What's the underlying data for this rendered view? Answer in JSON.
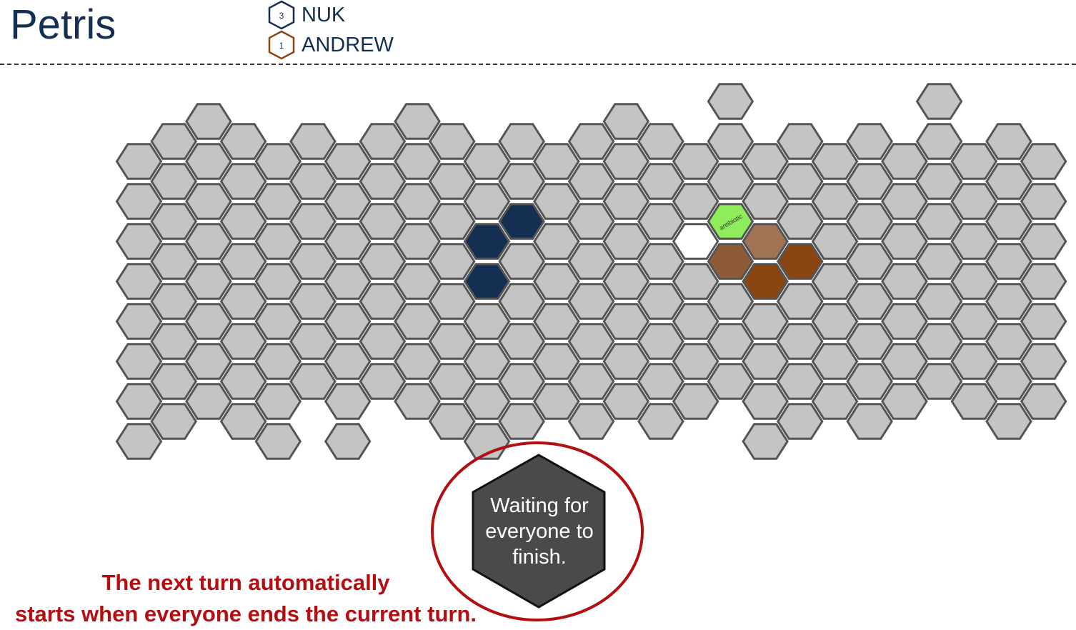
{
  "app": {
    "title": "Petris"
  },
  "players": [
    {
      "name": "NUK",
      "count": "3",
      "color": "#142f52"
    },
    {
      "name": "ANDREW",
      "count": "1",
      "color": "#8b4513"
    }
  ],
  "board": {
    "cell_color": "#c4c4c4",
    "stroke_color": "#555555",
    "cells": [
      {
        "col": 0,
        "row": 0,
        "color": "#c4c4c4"
      },
      {
        "col": 0,
        "row": 1,
        "color": "#c4c4c4"
      },
      {
        "col": 0,
        "row": 2,
        "color": "#c4c4c4"
      },
      {
        "col": 0,
        "row": 3,
        "color": "#c4c4c4"
      },
      {
        "col": 0,
        "row": 4,
        "color": "#c4c4c4"
      },
      {
        "col": 0,
        "row": 5,
        "color": "#c4c4c4"
      },
      {
        "col": 0,
        "row": 6,
        "color": "#c4c4c4"
      },
      {
        "col": 0,
        "row": 7,
        "color": "#c4c4c4"
      },
      {
        "col": 1,
        "row": 0,
        "color": "#c4c4c4"
      },
      {
        "col": 1,
        "row": 1,
        "color": "#c4c4c4"
      },
      {
        "col": 1,
        "row": 2,
        "color": "#c4c4c4"
      },
      {
        "col": 1,
        "row": 3,
        "color": "#c4c4c4"
      },
      {
        "col": 1,
        "row": 4,
        "color": "#c4c4c4"
      },
      {
        "col": 1,
        "row": 5,
        "color": "#c4c4c4"
      },
      {
        "col": 1,
        "row": 6,
        "color": "#c4c4c4"
      },
      {
        "col": 1,
        "row": 7,
        "color": "#c4c4c4"
      },
      {
        "col": 2,
        "row": -1,
        "color": "#c4c4c4"
      },
      {
        "col": 2,
        "row": 0,
        "color": "#c4c4c4"
      },
      {
        "col": 2,
        "row": 1,
        "color": "#c4c4c4"
      },
      {
        "col": 2,
        "row": 2,
        "color": "#c4c4c4"
      },
      {
        "col": 2,
        "row": 3,
        "color": "#c4c4c4"
      },
      {
        "col": 2,
        "row": 4,
        "color": "#c4c4c4"
      },
      {
        "col": 2,
        "row": 5,
        "color": "#c4c4c4"
      },
      {
        "col": 2,
        "row": 6,
        "color": "#c4c4c4"
      },
      {
        "col": 3,
        "row": 0,
        "color": "#c4c4c4"
      },
      {
        "col": 3,
        "row": 1,
        "color": "#c4c4c4"
      },
      {
        "col": 3,
        "row": 2,
        "color": "#c4c4c4"
      },
      {
        "col": 3,
        "row": 3,
        "color": "#c4c4c4"
      },
      {
        "col": 3,
        "row": 4,
        "color": "#c4c4c4"
      },
      {
        "col": 3,
        "row": 5,
        "color": "#c4c4c4"
      },
      {
        "col": 3,
        "row": 6,
        "color": "#c4c4c4"
      },
      {
        "col": 3,
        "row": 7,
        "color": "#c4c4c4"
      },
      {
        "col": 4,
        "row": 0,
        "color": "#c4c4c4"
      },
      {
        "col": 4,
        "row": 1,
        "color": "#c4c4c4"
      },
      {
        "col": 4,
        "row": 2,
        "color": "#c4c4c4"
      },
      {
        "col": 4,
        "row": 3,
        "color": "#c4c4c4"
      },
      {
        "col": 4,
        "row": 4,
        "color": "#c4c4c4"
      },
      {
        "col": 4,
        "row": 5,
        "color": "#c4c4c4"
      },
      {
        "col": 4,
        "row": 6,
        "color": "#c4c4c4"
      },
      {
        "col": 4,
        "row": 7,
        "color": "#c4c4c4"
      },
      {
        "col": 5,
        "row": 0,
        "color": "#c4c4c4"
      },
      {
        "col": 5,
        "row": 1,
        "color": "#c4c4c4"
      },
      {
        "col": 5,
        "row": 2,
        "color": "#c4c4c4"
      },
      {
        "col": 5,
        "row": 3,
        "color": "#c4c4c4"
      },
      {
        "col": 5,
        "row": 4,
        "color": "#c4c4c4"
      },
      {
        "col": 5,
        "row": 5,
        "color": "#c4c4c4"
      },
      {
        "col": 5,
        "row": 6,
        "color": "#c4c4c4"
      },
      {
        "col": 6,
        "row": 0,
        "color": "#c4c4c4"
      },
      {
        "col": 6,
        "row": 1,
        "color": "#c4c4c4"
      },
      {
        "col": 6,
        "row": 2,
        "color": "#c4c4c4"
      },
      {
        "col": 6,
        "row": 3,
        "color": "#c4c4c4"
      },
      {
        "col": 6,
        "row": 4,
        "color": "#c4c4c4"
      },
      {
        "col": 6,
        "row": 5,
        "color": "#c4c4c4"
      },
      {
        "col": 6,
        "row": 6,
        "color": "#c4c4c4"
      },
      {
        "col": 6,
        "row": 7,
        "color": "#c4c4c4"
      },
      {
        "col": 7,
        "row": 0,
        "color": "#c4c4c4"
      },
      {
        "col": 7,
        "row": 1,
        "color": "#c4c4c4"
      },
      {
        "col": 7,
        "row": 2,
        "color": "#c4c4c4"
      },
      {
        "col": 7,
        "row": 3,
        "color": "#c4c4c4"
      },
      {
        "col": 7,
        "row": 4,
        "color": "#c4c4c4"
      },
      {
        "col": 7,
        "row": 5,
        "color": "#c4c4c4"
      },
      {
        "col": 7,
        "row": 6,
        "color": "#c4c4c4"
      },
      {
        "col": 8,
        "row": -1,
        "color": "#c4c4c4"
      },
      {
        "col": 8,
        "row": 0,
        "color": "#c4c4c4"
      },
      {
        "col": 8,
        "row": 1,
        "color": "#c4c4c4"
      },
      {
        "col": 8,
        "row": 2,
        "color": "#c4c4c4"
      },
      {
        "col": 8,
        "row": 3,
        "color": "#c4c4c4"
      },
      {
        "col": 8,
        "row": 4,
        "color": "#c4c4c4"
      },
      {
        "col": 8,
        "row": 5,
        "color": "#c4c4c4"
      },
      {
        "col": 8,
        "row": 6,
        "color": "#c4c4c4"
      },
      {
        "col": 9,
        "row": 0,
        "color": "#c4c4c4"
      },
      {
        "col": 9,
        "row": 1,
        "color": "#c4c4c4"
      },
      {
        "col": 9,
        "row": 2,
        "color": "#c4c4c4"
      },
      {
        "col": 9,
        "row": 3,
        "color": "#c4c4c4"
      },
      {
        "col": 9,
        "row": 4,
        "color": "#c4c4c4"
      },
      {
        "col": 9,
        "row": 5,
        "color": "#c4c4c4"
      },
      {
        "col": 9,
        "row": 6,
        "color": "#c4c4c4"
      },
      {
        "col": 9,
        "row": 7,
        "color": "#c4c4c4"
      },
      {
        "col": 10,
        "row": 0,
        "color": "#c4c4c4"
      },
      {
        "col": 10,
        "row": 1,
        "color": "#c4c4c4"
      },
      {
        "col": 10,
        "row": 2,
        "color": "#142f52"
      },
      {
        "col": 10,
        "row": 3,
        "color": "#142f52"
      },
      {
        "col": 10,
        "row": 4,
        "color": "#c4c4c4"
      },
      {
        "col": 10,
        "row": 5,
        "color": "#c4c4c4"
      },
      {
        "col": 10,
        "row": 6,
        "color": "#c4c4c4"
      },
      {
        "col": 10,
        "row": 7,
        "color": "#c4c4c4"
      },
      {
        "col": 11,
        "row": 0,
        "color": "#c4c4c4"
      },
      {
        "col": 11,
        "row": 1,
        "color": "#c4c4c4"
      },
      {
        "col": 11,
        "row": 2,
        "color": "#142f52"
      },
      {
        "col": 11,
        "row": 3,
        "color": "#c4c4c4"
      },
      {
        "col": 11,
        "row": 4,
        "color": "#c4c4c4"
      },
      {
        "col": 11,
        "row": 5,
        "color": "#c4c4c4"
      },
      {
        "col": 11,
        "row": 6,
        "color": "#c4c4c4"
      },
      {
        "col": 11,
        "row": 7,
        "color": "#c4c4c4"
      },
      {
        "col": 12,
        "row": 0,
        "color": "#c4c4c4"
      },
      {
        "col": 12,
        "row": 1,
        "color": "#c4c4c4"
      },
      {
        "col": 12,
        "row": 2,
        "color": "#c4c4c4"
      },
      {
        "col": 12,
        "row": 3,
        "color": "#c4c4c4"
      },
      {
        "col": 12,
        "row": 4,
        "color": "#c4c4c4"
      },
      {
        "col": 12,
        "row": 5,
        "color": "#c4c4c4"
      },
      {
        "col": 12,
        "row": 6,
        "color": "#c4c4c4"
      },
      {
        "col": 13,
        "row": 0,
        "color": "#c4c4c4"
      },
      {
        "col": 13,
        "row": 1,
        "color": "#c4c4c4"
      },
      {
        "col": 13,
        "row": 2,
        "color": "#c4c4c4"
      },
      {
        "col": 13,
        "row": 3,
        "color": "#c4c4c4"
      },
      {
        "col": 13,
        "row": 4,
        "color": "#c4c4c4"
      },
      {
        "col": 13,
        "row": 5,
        "color": "#c4c4c4"
      },
      {
        "col": 13,
        "row": 6,
        "color": "#c4c4c4"
      },
      {
        "col": 13,
        "row": 7,
        "color": "#c4c4c4"
      },
      {
        "col": 14,
        "row": -1,
        "color": "#c4c4c4"
      },
      {
        "col": 14,
        "row": 0,
        "color": "#c4c4c4"
      },
      {
        "col": 14,
        "row": 1,
        "color": "#c4c4c4"
      },
      {
        "col": 14,
        "row": 2,
        "color": "#c4c4c4"
      },
      {
        "col": 14,
        "row": 3,
        "color": "#c4c4c4"
      },
      {
        "col": 14,
        "row": 4,
        "color": "#c4c4c4"
      },
      {
        "col": 14,
        "row": 5,
        "color": "#c4c4c4"
      },
      {
        "col": 14,
        "row": 6,
        "color": "#c4c4c4"
      },
      {
        "col": 15,
        "row": 0,
        "color": "#c4c4c4"
      },
      {
        "col": 15,
        "row": 1,
        "color": "#c4c4c4"
      },
      {
        "col": 15,
        "row": 2,
        "color": "#c4c4c4"
      },
      {
        "col": 15,
        "row": 3,
        "color": "#c4c4c4"
      },
      {
        "col": 15,
        "row": 4,
        "color": "#c4c4c4"
      },
      {
        "col": 15,
        "row": 5,
        "color": "#c4c4c4"
      },
      {
        "col": 15,
        "row": 6,
        "color": "#c4c4c4"
      },
      {
        "col": 15,
        "row": 7,
        "color": "#c4c4c4"
      },
      {
        "col": 16,
        "row": 0,
        "color": "#c4c4c4"
      },
      {
        "col": 16,
        "row": 1,
        "color": "#c4c4c4"
      },
      {
        "col": 16,
        "row": 2,
        "color": "#ffffff"
      },
      {
        "col": 16,
        "row": 3,
        "color": "#c4c4c4"
      },
      {
        "col": 16,
        "row": 4,
        "color": "#c4c4c4"
      },
      {
        "col": 16,
        "row": 5,
        "color": "#c4c4c4"
      },
      {
        "col": 16,
        "row": 6,
        "color": "#c4c4c4"
      },
      {
        "col": 17,
        "row": -1,
        "color": "#c4c4c4"
      },
      {
        "col": 17,
        "row": 0,
        "color": "#c4c4c4"
      },
      {
        "col": 17,
        "row": 1,
        "color": "#c4c4c4"
      },
      {
        "col": 17,
        "row": 2,
        "color": "#8fed5c",
        "label": "antibiotic"
      },
      {
        "col": 17,
        "row": 3,
        "color": "#8e5b36"
      },
      {
        "col": 17,
        "row": 4,
        "color": "#c4c4c4"
      },
      {
        "col": 17,
        "row": 5,
        "color": "#c4c4c4"
      },
      {
        "col": 17,
        "row": 6,
        "color": "#c4c4c4"
      },
      {
        "col": 18,
        "row": 0,
        "color": "#c4c4c4"
      },
      {
        "col": 18,
        "row": 1,
        "color": "#c4c4c4"
      },
      {
        "col": 18,
        "row": 2,
        "color": "#a07455"
      },
      {
        "col": 18,
        "row": 3,
        "color": "#8b4513"
      },
      {
        "col": 18,
        "row": 4,
        "color": "#c4c4c4"
      },
      {
        "col": 18,
        "row": 5,
        "color": "#c4c4c4"
      },
      {
        "col": 18,
        "row": 6,
        "color": "#c4c4c4"
      },
      {
        "col": 18,
        "row": 7,
        "color": "#c4c4c4"
      },
      {
        "col": 19,
        "row": 0,
        "color": "#c4c4c4"
      },
      {
        "col": 19,
        "row": 1,
        "color": "#c4c4c4"
      },
      {
        "col": 19,
        "row": 2,
        "color": "#c4c4c4"
      },
      {
        "col": 19,
        "row": 3,
        "color": "#8b4513"
      },
      {
        "col": 19,
        "row": 4,
        "color": "#c4c4c4"
      },
      {
        "col": 19,
        "row": 5,
        "color": "#c4c4c4"
      },
      {
        "col": 19,
        "row": 6,
        "color": "#c4c4c4"
      },
      {
        "col": 19,
        "row": 7,
        "color": "#c4c4c4"
      },
      {
        "col": 20,
        "row": 0,
        "color": "#c4c4c4"
      },
      {
        "col": 20,
        "row": 1,
        "color": "#c4c4c4"
      },
      {
        "col": 20,
        "row": 2,
        "color": "#c4c4c4"
      },
      {
        "col": 20,
        "row": 3,
        "color": "#c4c4c4"
      },
      {
        "col": 20,
        "row": 4,
        "color": "#c4c4c4"
      },
      {
        "col": 20,
        "row": 5,
        "color": "#c4c4c4"
      },
      {
        "col": 20,
        "row": 6,
        "color": "#c4c4c4"
      },
      {
        "col": 21,
        "row": 0,
        "color": "#c4c4c4"
      },
      {
        "col": 21,
        "row": 1,
        "color": "#c4c4c4"
      },
      {
        "col": 21,
        "row": 2,
        "color": "#c4c4c4"
      },
      {
        "col": 21,
        "row": 3,
        "color": "#c4c4c4"
      },
      {
        "col": 21,
        "row": 4,
        "color": "#c4c4c4"
      },
      {
        "col": 21,
        "row": 5,
        "color": "#c4c4c4"
      },
      {
        "col": 21,
        "row": 6,
        "color": "#c4c4c4"
      },
      {
        "col": 21,
        "row": 7,
        "color": "#c4c4c4"
      },
      {
        "col": 22,
        "row": 0,
        "color": "#c4c4c4"
      },
      {
        "col": 22,
        "row": 1,
        "color": "#c4c4c4"
      },
      {
        "col": 22,
        "row": 2,
        "color": "#c4c4c4"
      },
      {
        "col": 22,
        "row": 3,
        "color": "#c4c4c4"
      },
      {
        "col": 22,
        "row": 4,
        "color": "#c4c4c4"
      },
      {
        "col": 22,
        "row": 5,
        "color": "#c4c4c4"
      },
      {
        "col": 22,
        "row": 6,
        "color": "#c4c4c4"
      },
      {
        "col": 23,
        "row": -1,
        "color": "#c4c4c4"
      },
      {
        "col": 23,
        "row": 0,
        "color": "#c4c4c4"
      },
      {
        "col": 23,
        "row": 1,
        "color": "#c4c4c4"
      },
      {
        "col": 23,
        "row": 2,
        "color": "#c4c4c4"
      },
      {
        "col": 23,
        "row": 3,
        "color": "#c4c4c4"
      },
      {
        "col": 23,
        "row": 4,
        "color": "#c4c4c4"
      },
      {
        "col": 23,
        "row": 5,
        "color": "#c4c4c4"
      },
      {
        "col": 23,
        "row": 6,
        "color": "#c4c4c4"
      },
      {
        "col": 24,
        "row": 0,
        "color": "#c4c4c4"
      },
      {
        "col": 24,
        "row": 1,
        "color": "#c4c4c4"
      },
      {
        "col": 24,
        "row": 2,
        "color": "#c4c4c4"
      },
      {
        "col": 24,
        "row": 3,
        "color": "#c4c4c4"
      },
      {
        "col": 24,
        "row": 4,
        "color": "#c4c4c4"
      },
      {
        "col": 24,
        "row": 5,
        "color": "#c4c4c4"
      },
      {
        "col": 24,
        "row": 6,
        "color": "#c4c4c4"
      },
      {
        "col": 25,
        "row": 0,
        "color": "#c4c4c4"
      },
      {
        "col": 25,
        "row": 1,
        "color": "#c4c4c4"
      },
      {
        "col": 25,
        "row": 2,
        "color": "#c4c4c4"
      },
      {
        "col": 25,
        "row": 3,
        "color": "#c4c4c4"
      },
      {
        "col": 25,
        "row": 4,
        "color": "#c4c4c4"
      },
      {
        "col": 25,
        "row": 5,
        "color": "#c4c4c4"
      },
      {
        "col": 25,
        "row": 6,
        "color": "#c4c4c4"
      },
      {
        "col": 25,
        "row": 7,
        "color": "#c4c4c4"
      },
      {
        "col": 26,
        "row": 0,
        "color": "#c4c4c4"
      },
      {
        "col": 26,
        "row": 1,
        "color": "#c4c4c4"
      },
      {
        "col": 26,
        "row": 2,
        "color": "#c4c4c4"
      },
      {
        "col": 26,
        "row": 3,
        "color": "#c4c4c4"
      },
      {
        "col": 26,
        "row": 4,
        "color": "#c4c4c4"
      },
      {
        "col": 26,
        "row": 5,
        "color": "#c4c4c4"
      },
      {
        "col": 26,
        "row": 6,
        "color": "#c4c4c4"
      }
    ]
  },
  "status": {
    "waiting_text": "Waiting for everyone to finish.",
    "hint_line1": "The next turn automatically",
    "hint_line2": "starts when everyone ends the current turn.",
    "ring_color": "#b30f12",
    "hex_color": "#4a4a4a"
  }
}
